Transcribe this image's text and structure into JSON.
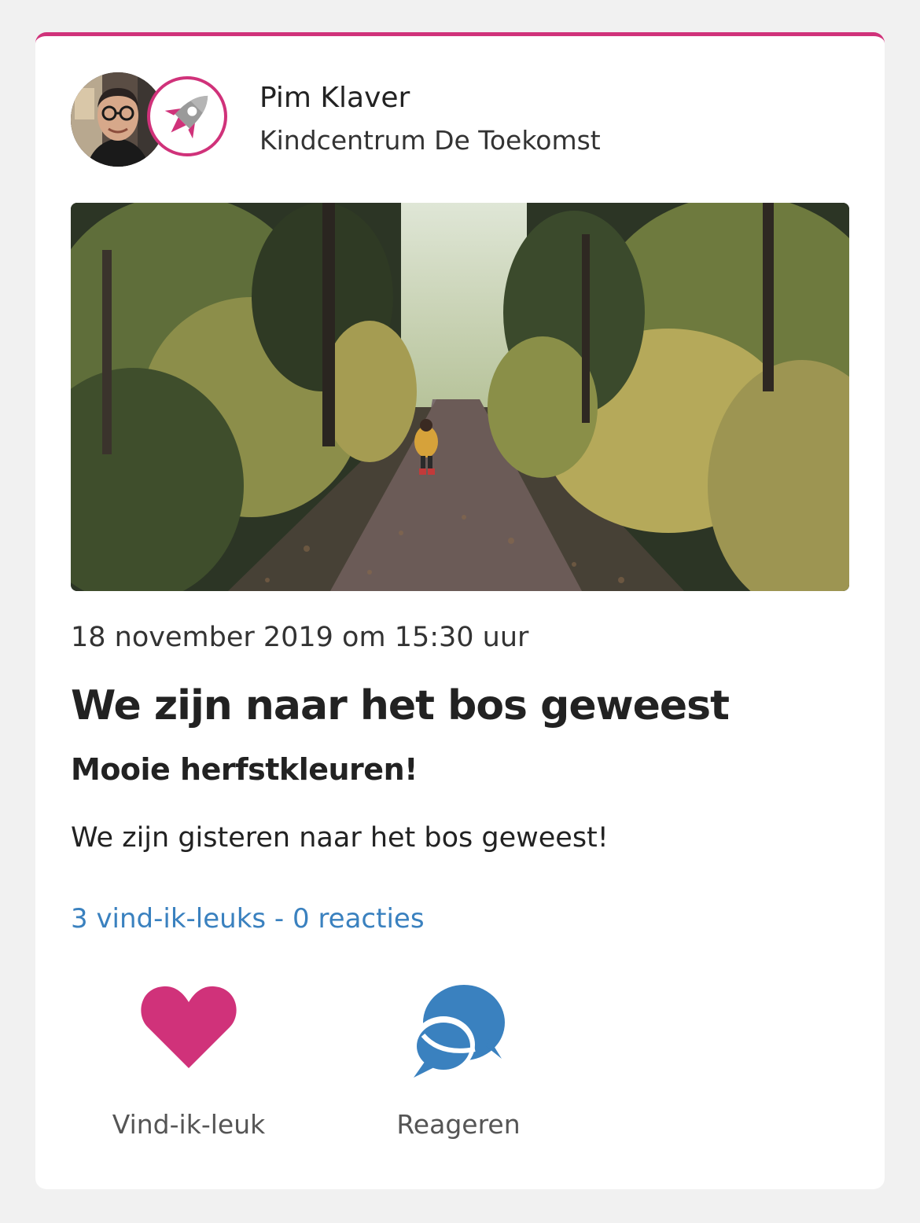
{
  "post": {
    "author_name": "Pim Klaver",
    "organization": "Kindcentrum De Toekomst",
    "date": "18 november 2019 om 15:30 uur",
    "title": "We zijn naar het bos geweest",
    "subtitle": "Mooie herfstkleuren!",
    "body": "We zijn gisteren naar het bos geweest!",
    "stats": "3 vind-ik-leuks - 0 reacties"
  },
  "actions": {
    "like_label": "Vind-ik-leuk",
    "comment_label": "Reageren"
  },
  "colors": {
    "accent": "#d0327a",
    "link": "#3a81bf",
    "comment_icon": "#3a81bf",
    "like_icon": "#d0327a",
    "background": "#f1f1f1"
  },
  "icons": {
    "avatar": "avatar",
    "organization_logo": "rocket-icon",
    "like": "heart-icon",
    "comment": "chat-bubbles-icon"
  }
}
